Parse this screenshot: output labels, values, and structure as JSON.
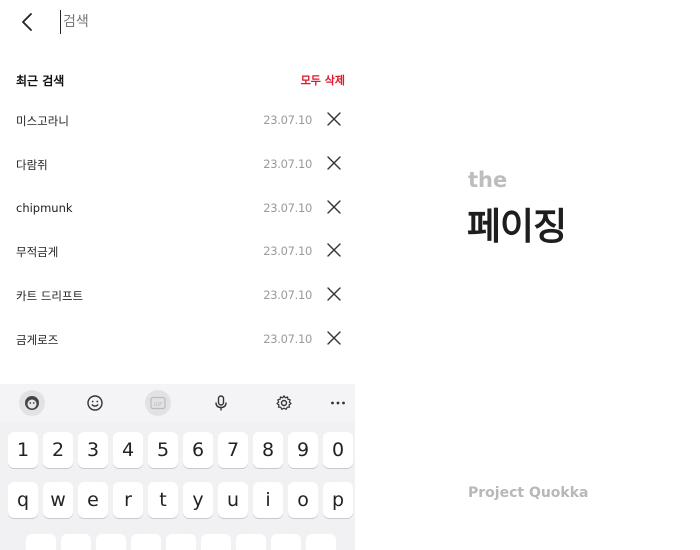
{
  "search": {
    "placeholder": "검색"
  },
  "recent": {
    "title": "최근 검색",
    "clear_all": "모두 삭제",
    "items": [
      {
        "term": "미스고라니",
        "date": "23.07.10"
      },
      {
        "term": "다람쥐",
        "date": "23.07.10"
      },
      {
        "term": "chipmunk",
        "date": "23.07.10"
      },
      {
        "term": "무적금게",
        "date": "23.07.10"
      },
      {
        "term": "카트 드리프트",
        "date": "23.07.10"
      },
      {
        "term": "금게로즈",
        "date": "23.07.10"
      }
    ]
  },
  "keyboard": {
    "toolbar": [
      "sticker-icon",
      "emoji-icon",
      "gif-icon",
      "microphone-icon",
      "settings-icon",
      "more-icon"
    ],
    "number_row": [
      "1",
      "2",
      "3",
      "4",
      "5",
      "6",
      "7",
      "8",
      "9",
      "0"
    ],
    "letter_row": [
      "q",
      "w",
      "e",
      "r",
      "t",
      "y",
      "u",
      "i",
      "o",
      "p"
    ]
  },
  "promo": {
    "the": "the",
    "title": "페이징",
    "subtitle": "Project Quokka"
  },
  "colors": {
    "accent": "#e2162a",
    "date": "#9a9a9a",
    "keyboard_bg": "#f1f1f3"
  }
}
